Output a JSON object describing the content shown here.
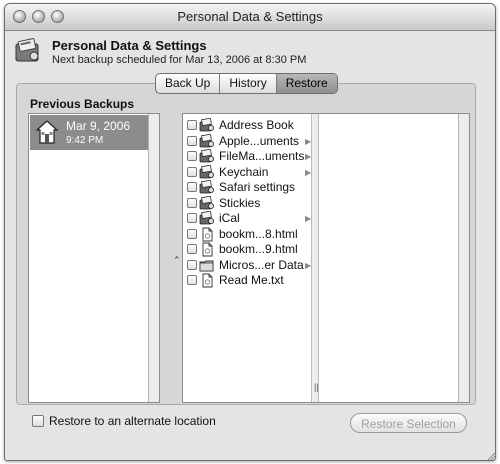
{
  "window": {
    "title": "Personal Data & Settings"
  },
  "header": {
    "title": "Personal Data & Settings",
    "subtitle": "Next backup scheduled for Mar 13, 2006 at 8:30 PM"
  },
  "tabs": [
    {
      "label": "Back Up",
      "active": false
    },
    {
      "label": "History",
      "active": false
    },
    {
      "label": "Restore",
      "active": true
    }
  ],
  "previous_backups": {
    "label": "Previous Backups",
    "items": [
      {
        "date": "Mar 9, 2006",
        "time": "9:42 PM",
        "selected": true
      }
    ]
  },
  "files": [
    {
      "label": "Address Book",
      "icon": "app-icon",
      "has_children": false
    },
    {
      "label": "Apple...uments",
      "icon": "app-icon",
      "has_children": true
    },
    {
      "label": "FileMa...uments",
      "icon": "app-icon",
      "has_children": true
    },
    {
      "label": "Keychain",
      "icon": "app-icon",
      "has_children": true
    },
    {
      "label": "Safari settings",
      "icon": "app-icon",
      "has_children": false
    },
    {
      "label": "Stickies",
      "icon": "app-icon",
      "has_children": false
    },
    {
      "label": "iCal",
      "icon": "app-icon",
      "has_children": true
    },
    {
      "label": "bookm...8.html",
      "icon": "document-icon",
      "has_children": false
    },
    {
      "label": "bookm...9.html",
      "icon": "document-icon",
      "has_children": false
    },
    {
      "label": "Micros...er Data",
      "icon": "folder-icon",
      "has_children": true
    },
    {
      "label": "Read Me.txt",
      "icon": "document-icon",
      "has_children": false
    }
  ],
  "footer": {
    "alternate_location_label": "Restore to an alternate location",
    "alternate_location_checked": false,
    "restore_button": "Restore Selection",
    "restore_enabled": false
  },
  "colors": {
    "selection": "#8c8c8c",
    "window_bg": "#e4e4e4",
    "panel_bg": "#d6d6d6"
  }
}
